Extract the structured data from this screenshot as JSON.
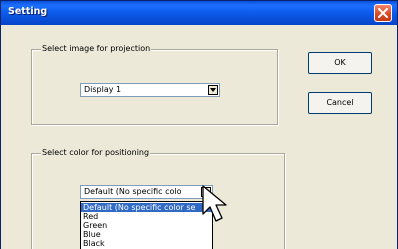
{
  "window": {
    "title": "Setting"
  },
  "projection": {
    "group_label": "Select image for projection",
    "selected": "Display 1"
  },
  "positioning": {
    "group_label": "Select color for positioning",
    "selected": "Default (No specific colo",
    "options": [
      "Default (No specific color se",
      "Red",
      "Green",
      "Blue",
      "Black"
    ],
    "highlighted_index": 0
  },
  "buttons": {
    "ok": "OK",
    "cancel": "Cancel"
  },
  "colors": {
    "titlebar": "#0a58e8",
    "dialog_bg": "#ece9d8",
    "highlight": "#316ac5",
    "close": "#d94a26"
  },
  "icons": {
    "close": "close-icon",
    "dropdown": "chevron-down-icon",
    "cursor": "mouse-pointer-icon"
  }
}
